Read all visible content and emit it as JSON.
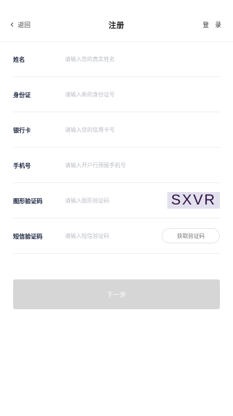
{
  "header": {
    "back_label": "返回",
    "title": "注册",
    "login_label": "登 录"
  },
  "form": {
    "fields": [
      {
        "label": "姓名",
        "placeholder": "请输入您的真实姓名",
        "value": ""
      },
      {
        "label": "身份证",
        "placeholder": "请输入新的身份证号",
        "value": ""
      },
      {
        "label": "银行卡",
        "placeholder": "请输入您的信用卡号",
        "value": ""
      },
      {
        "label": "手机号",
        "placeholder": "请输入开户行预留手机号",
        "value": ""
      },
      {
        "label": "图形验证码",
        "placeholder": "请输入图形验证码",
        "value": ""
      },
      {
        "label": "短信验证码",
        "placeholder": "请输入短信验证码",
        "value": ""
      }
    ],
    "captcha_text": "SXVR",
    "sms_button_label": "获取验证码"
  },
  "next_button_label": "下一步",
  "colors": {
    "captcha_bg": "#e3e0ee",
    "captcha_text": "#2c0f40",
    "next_button_bg": "#d6d6d6"
  },
  "icons": {
    "back": "chevron-left-icon"
  }
}
